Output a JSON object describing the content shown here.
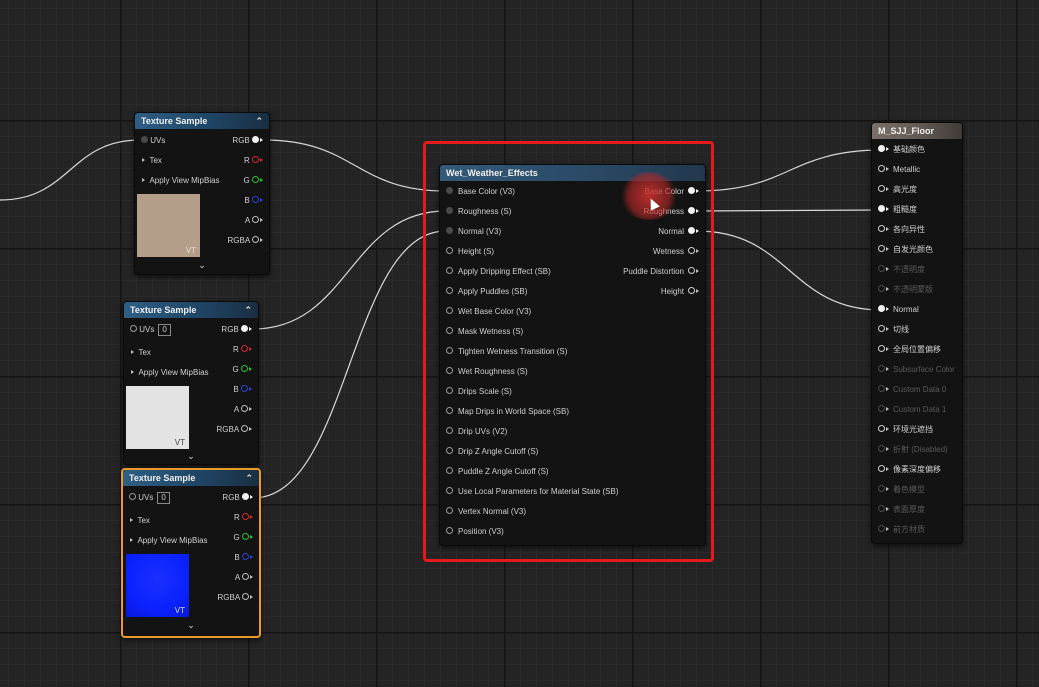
{
  "colors": {
    "selection_outline": "#e89a2c",
    "highlight_box": "#e6191d",
    "header": "#2f5f85"
  },
  "texture_nodes": [
    {
      "title": "Texture Sample",
      "uv_label": "UVs",
      "uv_value": "",
      "tex_label": "Tex",
      "mip_label": "Apply View MipBias",
      "outputs": [
        "RGB",
        "R",
        "G",
        "B",
        "A",
        "RGBA"
      ],
      "preview_color": "#b49e8a",
      "vt_label": "VT",
      "expand_icon": "chevron-down-icon"
    },
    {
      "title": "Texture Sample",
      "uv_label": "UVs",
      "uv_value": "0",
      "tex_label": "Tex",
      "mip_label": "Apply View MipBias",
      "outputs": [
        "RGB",
        "R",
        "G",
        "B",
        "A",
        "RGBA"
      ],
      "preview_color": "#e3e3e3",
      "vt_label": "VT",
      "expand_icon": "chevron-down-icon"
    },
    {
      "title": "Texture Sample",
      "uv_label": "UVs",
      "uv_value": "0",
      "tex_label": "Tex",
      "mip_label": "Apply View MipBias",
      "outputs": [
        "RGB",
        "R",
        "G",
        "B",
        "A",
        "RGBA"
      ],
      "preview_color": "#0b22ff",
      "vt_label": "VT",
      "expand_icon": "chevron-down-icon"
    }
  ],
  "weather_node": {
    "title": "Wet_Weather_Effects",
    "inputs": [
      "Base Color (V3)",
      "Roughness (S)",
      "Normal (V3)",
      "Height (S)",
      "Apply Dripping Effect (SB)",
      "Apply Puddles (SB)",
      "Wet Base Color (V3)",
      "Mask Wetness (S)",
      "Tighten Wetness Transition (S)",
      "Wet Roughness (S)",
      "Drips Scale (S)",
      "Map Drips in World Space (SB)",
      "Drip UVs (V2)",
      "Drip Z Angle Cutoff (S)",
      "Puddle Z Angle Cutoff (S)",
      "Use Local Parameters for Material State (SB)",
      "Vertex Normal (V3)",
      "Position (V3)"
    ],
    "outputs": [
      "Base Color",
      "Roughness",
      "Normal",
      "Wetness",
      "Puddle Distortion",
      "Height"
    ]
  },
  "material_node": {
    "title": "M_SJJ_Floor",
    "inputs": [
      {
        "label": "基础颜色",
        "enabled": true
      },
      {
        "label": "Metallic",
        "enabled": true
      },
      {
        "label": "高光度",
        "enabled": true
      },
      {
        "label": "粗糙度",
        "enabled": true
      },
      {
        "label": "各向异性",
        "enabled": true
      },
      {
        "label": "自发光颜色",
        "enabled": true
      },
      {
        "label": "不透明度",
        "enabled": false
      },
      {
        "label": "不透明蒙版",
        "enabled": false
      },
      {
        "label": "Normal",
        "enabled": true
      },
      {
        "label": "切线",
        "enabled": true
      },
      {
        "label": "全局位置偏移",
        "enabled": true
      },
      {
        "label": "Subsurface Color",
        "enabled": false
      },
      {
        "label": "Custom Data 0",
        "enabled": false
      },
      {
        "label": "Custom Data 1",
        "enabled": false
      },
      {
        "label": "环境光遮挡",
        "enabled": true
      },
      {
        "label": "折射 (Disabled)",
        "enabled": false
      },
      {
        "label": "像素深度偏移",
        "enabled": true
      },
      {
        "label": "着色模型",
        "enabled": false
      },
      {
        "label": "表面厚度",
        "enabled": false
      },
      {
        "label": "前方材质",
        "enabled": false
      }
    ]
  }
}
